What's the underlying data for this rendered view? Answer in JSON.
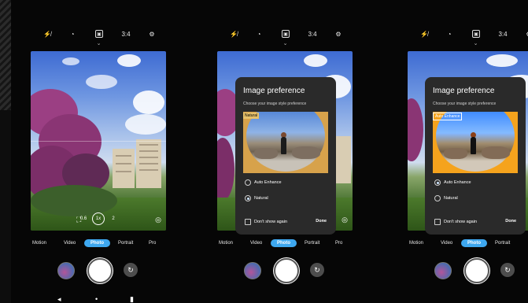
{
  "topbar_icons": [
    "flash-off-icon",
    "timer-icon",
    "motion-photo-icon",
    "aspect-ratio-icon",
    "settings-icon"
  ],
  "topbar_aspect": "3:4",
  "modes": [
    "Motion",
    "Video",
    "Photo",
    "Portrait",
    "Pro"
  ],
  "selected_mode": "Photo",
  "zoom": {
    "left": "0.6",
    "center": "1x",
    "right": "2"
  },
  "dialog": {
    "title": "Image preference",
    "subtitle": "Choose your image style preference",
    "tag_natural": "Natural",
    "tag_auto": "Auto Enhance",
    "opt_auto": "Auto Enhance",
    "opt_natural": "Natural",
    "dont_show": "Don't show again",
    "done": "Done"
  },
  "colors": {
    "accent": "#3ea8f0",
    "dialog_bg": "#2a2a2a"
  }
}
